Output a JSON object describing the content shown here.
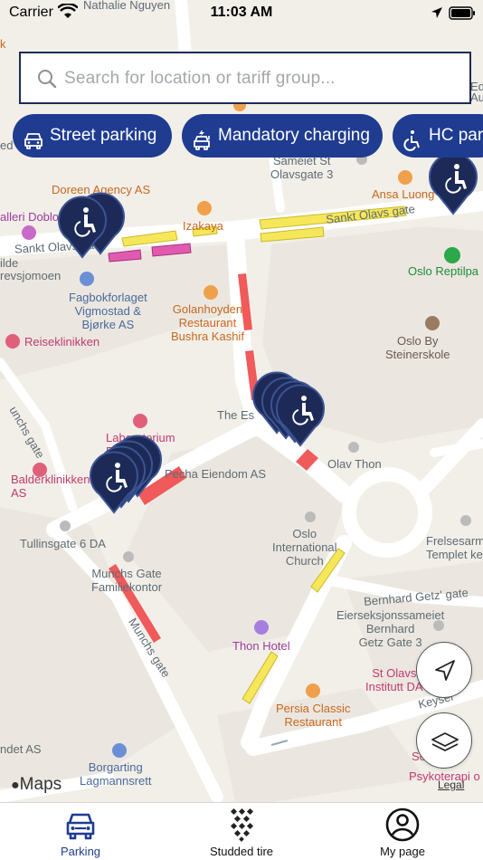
{
  "status_bar": {
    "carrier": "Carrier",
    "time": "11:03 AM"
  },
  "search": {
    "placeholder": "Search for location or tariff group..."
  },
  "filters": [
    {
      "label": "Street parking",
      "icon": "car-icon"
    },
    {
      "label": "Mandatory charging",
      "icon": "ev-charging-icon"
    },
    {
      "label": "HC par",
      "icon": "wheelchair-icon"
    }
  ],
  "map": {
    "pois": [
      {
        "text": "Nathalie Nguyen"
      },
      {
        "text": "Sameiet St\nOlavsgate 3"
      },
      {
        "text": "Doreen Agency AS"
      },
      {
        "text": "Ansa Luong"
      },
      {
        "text": "Izakaya"
      },
      {
        "text": "alleri Doblo"
      },
      {
        "text": "Sankt Olavs gate"
      },
      {
        "text": "Sankt Olavs gate"
      },
      {
        "text": "ilde"
      },
      {
        "text": "revsjomoen"
      },
      {
        "text": "Oslo Reptilpa"
      },
      {
        "text": "Fagbokforlaget\nVigmostad &\nBjørke AS"
      },
      {
        "text": "Golanhoyden\nRestaurant\nBushra Kashif"
      },
      {
        "text": "Reiseklinikken"
      },
      {
        "text": "Oslo By\nSteinerskole"
      },
      {
        "text": "The Es"
      },
      {
        "text": "Laboratorium\nFo        AS"
      },
      {
        "text": "Balderklinikken\nAS"
      },
      {
        "text": "Pecha Eiendom AS"
      },
      {
        "text": "Olav Thon"
      },
      {
        "text": "Tullinsgate 6 DA"
      },
      {
        "text": "Oslo\nInternational\nChurch"
      },
      {
        "text": "Frelsesarm\nTemplet ke"
      },
      {
        "text": "Munchs Gate\nFamiliekontor"
      },
      {
        "text": "Bernhard Getz' gate"
      },
      {
        "text": "Eierseksjonssameiet\nBernhard\nGetz Gate 3"
      },
      {
        "text": "Thon Hotel"
      },
      {
        "text": "Munchs gate"
      },
      {
        "text": "St Olavs\nInstitutt DA"
      },
      {
        "text": "Keyser"
      },
      {
        "text": "Persia Classic\nRestaurant"
      },
      {
        "text": "Borgarting\nLagmannsrett"
      },
      {
        "text": "Psykoterapi o"
      },
      {
        "text": "ndet AS"
      },
      {
        "text": "Sc"
      },
      {
        "text": "Ed"
      },
      {
        "text": "Au"
      },
      {
        "text": "ed"
      },
      {
        "text": "unchs gate"
      },
      {
        "text": "k"
      }
    ],
    "attribution": "Maps",
    "legal": "Legal",
    "colors": {
      "street_parking": "#f6e75a",
      "mandatory_charging": "#e05bb0",
      "no_parking": "#f05a5a",
      "pin": "#1d2a57",
      "accent": "#1f3c91"
    }
  },
  "controls": {
    "locate_icon": "navigation-arrow-icon",
    "layers_icon": "layers-icon"
  },
  "tabs": [
    {
      "label": "Parking",
      "icon": "car-icon",
      "active": true
    },
    {
      "label": "Studded tire",
      "icon": "tire-tread-icon",
      "active": false
    },
    {
      "label": "My page",
      "icon": "user-icon",
      "active": false
    }
  ]
}
